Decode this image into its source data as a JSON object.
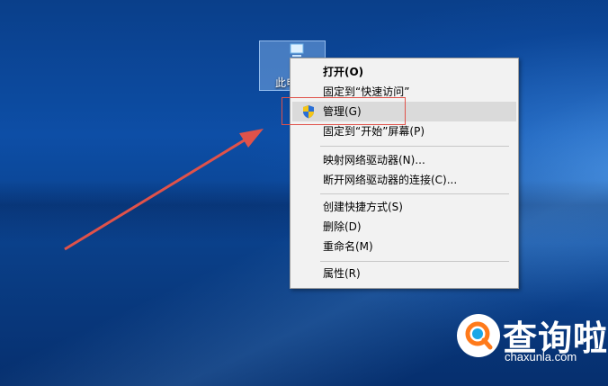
{
  "desktop": {
    "icon_label": "此电",
    "icon_name": "computer-icon"
  },
  "context_menu": {
    "items": [
      {
        "label": "打开(O)"
      },
      {
        "label": "固定到“快速访问”"
      },
      {
        "label": "管理(G)"
      },
      {
        "label": "固定到“开始”屏幕(P)"
      },
      {
        "label": "映射网络驱动器(N)..."
      },
      {
        "label": "断开网络驱动器的连接(C)..."
      },
      {
        "label": "创建快捷方式(S)"
      },
      {
        "label": "删除(D)"
      },
      {
        "label": "重命名(M)"
      },
      {
        "label": "属性(R)"
      }
    ],
    "highlighted_index": 2,
    "highlight_color": "#e0524a"
  },
  "watermark": {
    "brand": "查询啦",
    "url": "chaxunla.com",
    "icon_name": "search-logo-icon"
  }
}
